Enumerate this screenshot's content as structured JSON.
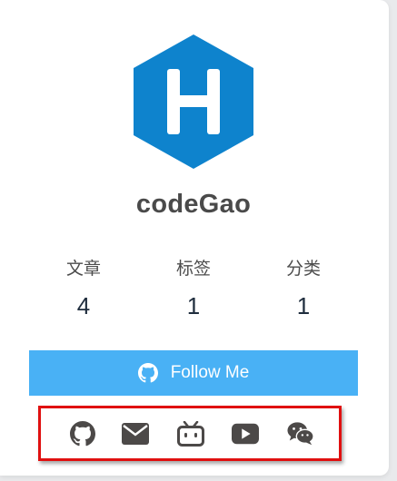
{
  "profile": {
    "name": "codeGao",
    "avatar_icon": "hexo-logo-icon",
    "avatar_color": "#0e83cd"
  },
  "stats": [
    {
      "label": "文章",
      "value": "4"
    },
    {
      "label": "标签",
      "value": "1"
    },
    {
      "label": "分类",
      "value": "1"
    }
  ],
  "follow_button": {
    "label": "Follow Me",
    "icon": "github-icon",
    "color": "#49b1f5"
  },
  "social_links": [
    {
      "icon": "github-icon"
    },
    {
      "icon": "envelope-icon"
    },
    {
      "icon": "bilibili-icon"
    },
    {
      "icon": "youtube-icon"
    },
    {
      "icon": "wechat-icon"
    }
  ],
  "highlight_color": "#e01010"
}
